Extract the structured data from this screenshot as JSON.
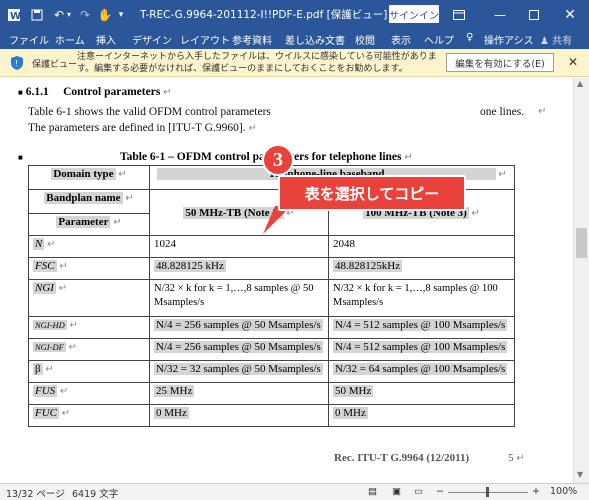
{
  "window": {
    "title": "T-REC-G.9964-201112-I!!PDF-E.pdf  [保護ビュー]  -  Word",
    "signin_label": "サインイン"
  },
  "ribbon": {
    "tabs": [
      "ファイル",
      "ホーム",
      "挿入",
      "デザイン",
      "レイアウト",
      "参考資料",
      "差し込み文書",
      "校閲",
      "表示",
      "ヘルプ",
      "操作アシス",
      "共有"
    ]
  },
  "protected_view": {
    "label": "保護ビュー",
    "message": "注意ーインターネットから入手したファイルは、ウイルスに感染している可能性があります。編集する必要がなければ、保護ビューのままにしておくことをお勧めします。",
    "enable_button": "編集を有効にする(E)"
  },
  "document": {
    "section_num": "6.1.1",
    "section_title": "Control parameters",
    "para_line1": "Table 6-1 shows the valid OFDM control parameters",
    "para_line1_end": "one lines.",
    "para_line2": "The parameters are defined in [ITU-T G.9960].",
    "table_title": "Table 6-1 – OFDM control parameters for telephone lines",
    "table": {
      "domain_type": "Domain type",
      "telephone_baseband": "Telephone-line baseband",
      "bandplan_name": "Bandplan name",
      "parameter": "Parameter",
      "col_50": "50 MHz-TB (Note 2)",
      "col_100": "100 MHz-TB (Note 3)",
      "rows": [
        {
          "param": "N",
          "v50": "1024",
          "v100": "2048"
        },
        {
          "param": "FSC",
          "v50": "48.828125 kHz",
          "v100": "48.828125kHz"
        },
        {
          "param": "NGI",
          "v50": "N/32 × k for k = 1,…,8 samples @ 50 Msamples/s",
          "v100": "N/32 × k for k = 1,…,8 samples @ 100 Msamples/s"
        },
        {
          "param": "NGI-HD",
          "v50": "N/4 = 256 samples @ 50 Msamples/s",
          "v100": "N/4 = 512 samples @ 100 Msamples/s"
        },
        {
          "param": "NGI-DF",
          "v50": "N/4 = 256 samples @ 50 Msamples/s",
          "v100": "N/4 = 512 samples @ 100 Msamples/s"
        },
        {
          "param": "β",
          "v50": "N/32 = 32 samples @ 50 Msamples/s",
          "v100": "N/32 = 64 samples @ 100 Msamples/s"
        },
        {
          "param": "FUS",
          "v50": "25 MHz",
          "v100": "50 MHz"
        },
        {
          "param": "FUC",
          "v50": "0 MHz",
          "v100": "0 MHz"
        }
      ]
    },
    "footer_ref": "Rec. ITU-T G.9964 (12/2011)",
    "footer_page": "5"
  },
  "callout": {
    "number": "3",
    "text": "表を選択してコピー"
  },
  "status": {
    "page": "13/32 ページ",
    "words": "6419 文字",
    "zoom": "100%"
  },
  "colors": {
    "word_blue": "#2b579a",
    "callout_red": "#e8423b",
    "pv_yellow": "#fdf3cc"
  }
}
